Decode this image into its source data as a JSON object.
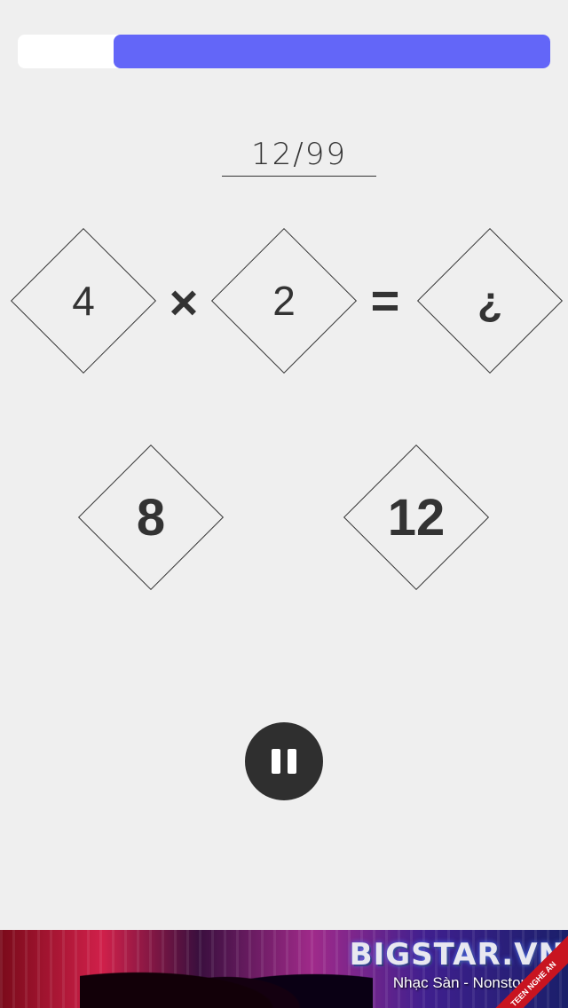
{
  "progress": {
    "remaining_fraction": 0.82,
    "fill_color": "#6366f8"
  },
  "counter": {
    "text": "12/99"
  },
  "equation": {
    "operand_a": "4",
    "operator": "×",
    "operand_b": "2",
    "equals": "=",
    "unknown": "¿"
  },
  "answers": [
    {
      "value": "8"
    },
    {
      "value": "12"
    }
  ],
  "controls": {
    "pause_icon": "pause-icon",
    "pause_bg": "#2f2f2f"
  },
  "ad": {
    "brand": "BIGSTAR.VN",
    "tagline": "Nhạc Sàn - Nonstop",
    "ribbon": "TEEN NGHE AN"
  }
}
